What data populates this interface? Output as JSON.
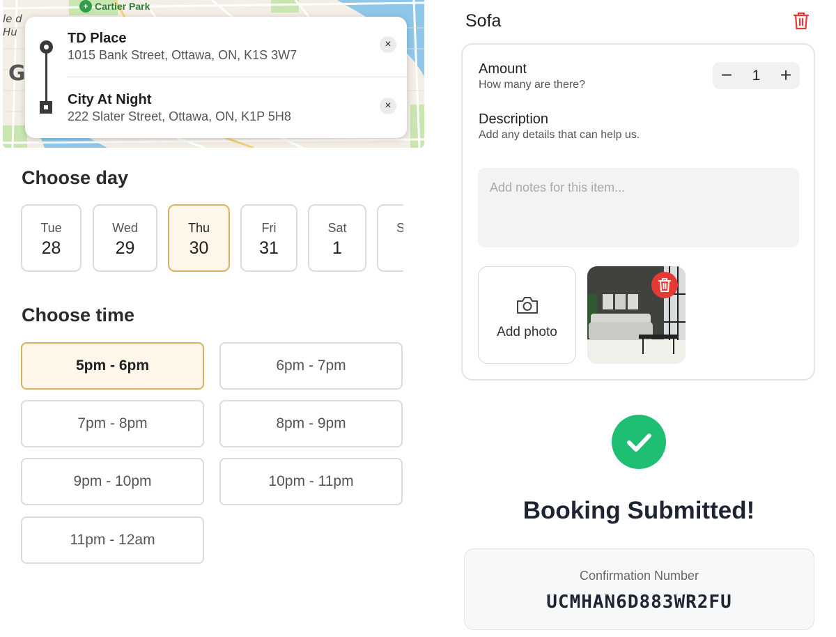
{
  "map": {
    "park_label": "Cartier Park",
    "labels": [
      "le d",
      "Hu",
      "G"
    ],
    "route": {
      "origin": {
        "name": "TD Place",
        "address": "1015 Bank Street, Ottawa, ON, K1S 3W7"
      },
      "destination": {
        "name": "City At Night",
        "address": "222 Slater Street, Ottawa, ON, K1P 5H8"
      },
      "clear_icon": "×"
    }
  },
  "day_picker": {
    "title": "Choose day",
    "days": [
      {
        "name": "Tue",
        "num": "28",
        "selected": false
      },
      {
        "name": "Wed",
        "num": "29",
        "selected": false
      },
      {
        "name": "Thu",
        "num": "30",
        "selected": true
      },
      {
        "name": "Fri",
        "num": "31",
        "selected": false
      },
      {
        "name": "Sat",
        "num": "1",
        "selected": false
      },
      {
        "name": "S",
        "num": "",
        "selected": false
      }
    ]
  },
  "time_picker": {
    "title": "Choose time",
    "slots": [
      {
        "label": "5pm - 6pm",
        "selected": true
      },
      {
        "label": "6pm - 7pm",
        "selected": false
      },
      {
        "label": "7pm - 8pm",
        "selected": false
      },
      {
        "label": "8pm - 9pm",
        "selected": false
      },
      {
        "label": "9pm - 10pm",
        "selected": false
      },
      {
        "label": "10pm - 11pm",
        "selected": false
      },
      {
        "label": "11pm - 12am",
        "selected": false
      }
    ]
  },
  "item": {
    "title": "Sofa",
    "amount_label": "Amount",
    "amount_hint": "How many are there?",
    "amount_value": "1",
    "minus": "−",
    "plus": "+",
    "description_label": "Description",
    "description_hint": "Add any details that can help us.",
    "notes_placeholder": "Add notes for this item...",
    "add_photo_label": "Add photo"
  },
  "confirmation": {
    "title": "Booking Submitted!",
    "number_label": "Confirmation Number",
    "number": "UCMHAN6D883WR2FU"
  },
  "colors": {
    "accent_border": "#d6b360",
    "accent_fill": "#fdf6e9",
    "danger": "#e53935",
    "success": "#1fbf73"
  }
}
